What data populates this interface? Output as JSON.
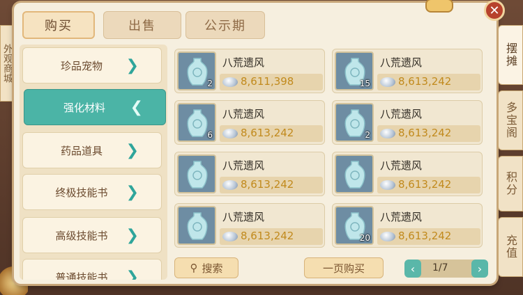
{
  "tabs": {
    "buy": "购买",
    "sell": "出售",
    "notice": "公示期"
  },
  "left_tag": "外观商城",
  "categories": [
    {
      "label": "珍品宠物"
    },
    {
      "label": "强化材料"
    },
    {
      "label": "药品道具"
    },
    {
      "label": "终极技能书"
    },
    {
      "label": "高级技能书"
    },
    {
      "label": "普通技能书"
    }
  ],
  "items": [
    {
      "name": "八荒遗风",
      "qty": "2",
      "price": "8,611,398"
    },
    {
      "name": "八荒遗风",
      "qty": "15",
      "price": "8,613,242"
    },
    {
      "name": "八荒遗风",
      "qty": "6",
      "price": "8,613,242"
    },
    {
      "name": "八荒遗风",
      "qty": "2",
      "price": "8,613,242"
    },
    {
      "name": "八荒遗风",
      "qty": "",
      "price": "8,613,242"
    },
    {
      "name": "八荒遗风",
      "qty": "",
      "price": "8,613,242"
    },
    {
      "name": "八荒遗风",
      "qty": "",
      "price": "8,613,242"
    },
    {
      "name": "八荒遗风",
      "qty": "20",
      "price": "8,613,242"
    }
  ],
  "footer": {
    "search": "搜索",
    "buy_page": "一页购买",
    "page": "1/7",
    "prev": "‹",
    "next": "›"
  },
  "side_tabs": [
    "摆摊",
    "多宝阁",
    "积分",
    "充值"
  ],
  "close": "✕",
  "colors": {
    "accent": "#4bb4a6",
    "price": "#c18a1d"
  }
}
